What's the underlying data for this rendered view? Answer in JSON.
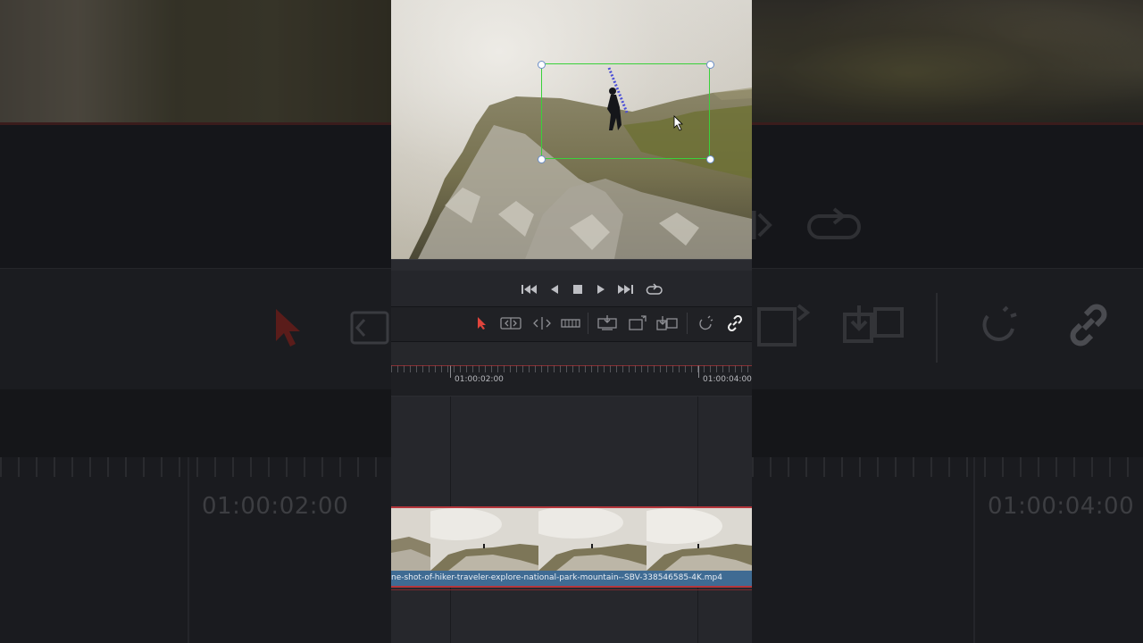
{
  "transport": {
    "buttons": [
      {
        "name": "skip-to-start-button",
        "glyph": "⏮"
      },
      {
        "name": "play-reverse-button",
        "glyph": "◀"
      },
      {
        "name": "stop-button",
        "glyph": "■"
      },
      {
        "name": "play-button",
        "glyph": "▶"
      },
      {
        "name": "skip-to-end-button",
        "glyph": "⏭"
      },
      {
        "name": "loop-button",
        "glyph": "↻"
      }
    ]
  },
  "timeline": {
    "timecodes": [
      "01:00:02:00",
      "01:00:04:00"
    ],
    "clip_filename": "ne-shot-of-hiker-traveler-explore-national-park-mountain--SBV-338546585-4K.mp4"
  },
  "colors": {
    "selection_tool": "#e0443c",
    "transform_box": "#3ad13a",
    "clip_label": "#3f6b93",
    "clip_border": "#b5363c"
  }
}
